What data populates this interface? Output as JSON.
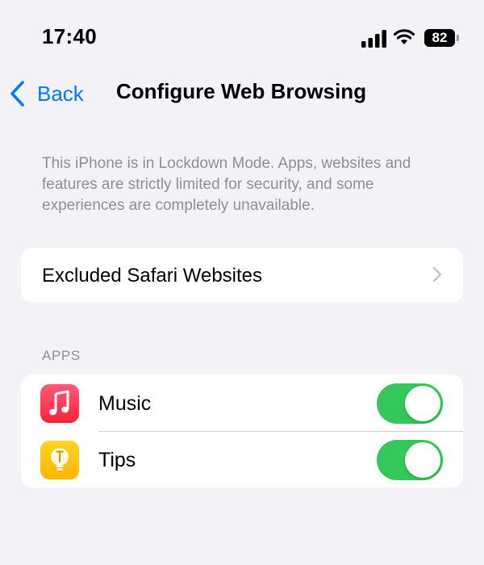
{
  "status_bar": {
    "time": "17:40",
    "battery_level": "82",
    "icons": [
      "cellular-signal-icon",
      "wifi-icon",
      "battery-icon"
    ]
  },
  "nav": {
    "back_label": "Back",
    "title": "Configure Web Browsing"
  },
  "description": "This iPhone is in Lockdown Mode. Apps, websites and features are strictly limited for security, and some experiences are completely unavailable.",
  "excluded_websites": {
    "label": "Excluded Safari Websites",
    "icon": "chevron-right-icon"
  },
  "apps_section": {
    "header": "APPS",
    "items": [
      {
        "label": "Music",
        "icon": "music-app-icon",
        "enabled": true
      },
      {
        "label": "Tips",
        "icon": "tips-app-icon",
        "enabled": true
      }
    ]
  },
  "colors": {
    "accent": "#007aff",
    "toggle_on": "#34c759",
    "background": "#f2f2f7",
    "secondary_text": "#8e8e93"
  }
}
